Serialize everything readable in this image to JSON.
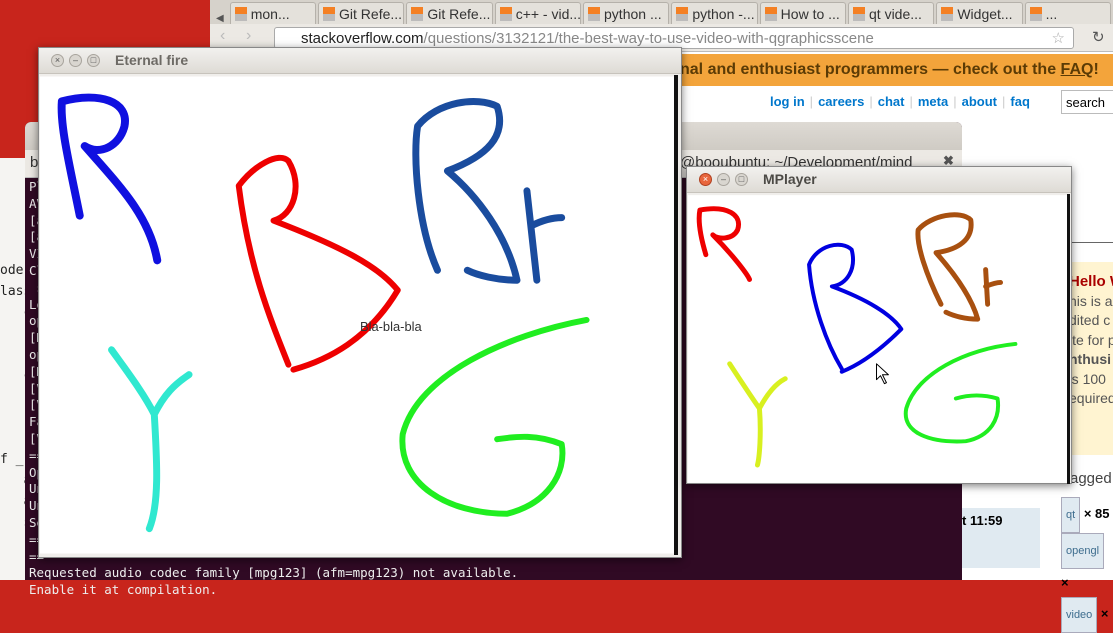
{
  "browser": {
    "tabs": [
      {
        "label": "mon..."
      },
      {
        "label": "Git Refe..."
      },
      {
        "label": "Git Refe..."
      },
      {
        "label": "c++ - vid..."
      },
      {
        "label": "python ..."
      },
      {
        "label": "python -..."
      },
      {
        "label": "How to ..."
      },
      {
        "label": "qt vide..."
      },
      {
        "label": "Widget..."
      },
      {
        "label": "..."
      }
    ],
    "url_host": "stackoverflow.com",
    "url_path": "/questions/3132121/the-best-way-to-use-video-with-qgraphicsscene",
    "banner": "nal and enthusiast programmers — check out the",
    "banner_link": "FAQ",
    "banner_end": "!",
    "nav": [
      "log in",
      "careers",
      "chat",
      "meta",
      "about",
      "faq"
    ],
    "search_placeholder": "search",
    "hello_title": "Hello W",
    "hello_lines": [
      "his is a",
      "dited c",
      "ite for p",
      "nthusi",
      "'s 100",
      "equired"
    ],
    "tagged": "agged",
    "tags": [
      {
        "name": "qt",
        "count": "× 85"
      },
      {
        "name": "opengl",
        "count": "×"
      },
      {
        "name": "video",
        "count": "×"
      }
    ],
    "time": "t 11:59",
    "accent": "#f3a43b"
  },
  "terminal": {
    "tab_left": "b",
    "tab_title": "@booubuntu: ~/Development/mind",
    "lines": [
      "Pl",
      "AV",
      "[a",
      "[a",
      "VI",
      "Cl",
      " s",
      "Lo",
      "op",
      "[M",
      "op",
      "[M",
      "[V",
      "[V",
      "Fa",
      "[V",
      "==",
      "Op",
      "Un",
      "Un",
      "Se",
      "==",
      "==",
      "Requested audio codec family [mpg123] (afm=mpg123) not available.",
      "Enable it at compilation."
    ]
  },
  "editor": {
    "lines": [
      "ode",
      "lass",
      "   c",
      "",
      "",
      "   c",
      "",
      "",
      "",
      "f _",
      "   a",
      "   a",
      "   s",
      "",
      "   r",
      "   v",
      "   p",
      "   F",
      "   F"
    ]
  },
  "eternal_fire": {
    "title": "Eternal fire",
    "label": "Bla-bla-bla"
  },
  "mplayer": {
    "title": "MPlayer"
  }
}
